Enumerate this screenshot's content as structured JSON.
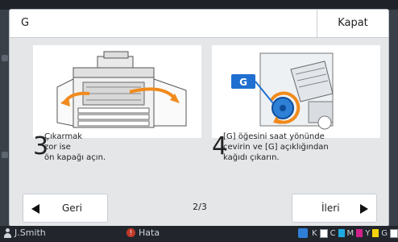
{
  "dialog": {
    "title": "G",
    "close_label": "Kapat",
    "steps": [
      {
        "number": "3",
        "caption_lines": [
          "Çıkarmak",
          "zor ise",
          "ön kapağı açın."
        ]
      },
      {
        "number": "4",
        "caption_lines": [
          "[G] öğesini saat yönünde",
          "çevirin ve [G] açıklığından",
          "kağıdı çıkarın."
        ]
      }
    ],
    "callout_label": "G",
    "back_label": "Geri",
    "next_label": "İleri",
    "page_indicator": "2/3"
  },
  "statusbar": {
    "user": "J.Smith",
    "error": "Hata",
    "inks": [
      "K",
      "C",
      "M",
      "Y",
      "G"
    ]
  },
  "colors": {
    "accent_blue": "#1f6fd0",
    "arrow_orange": "#f08a1c",
    "ink_cyan": "#20a8e0",
    "ink_magenta": "#d0218a",
    "ink_yellow": "#f5d20a"
  }
}
